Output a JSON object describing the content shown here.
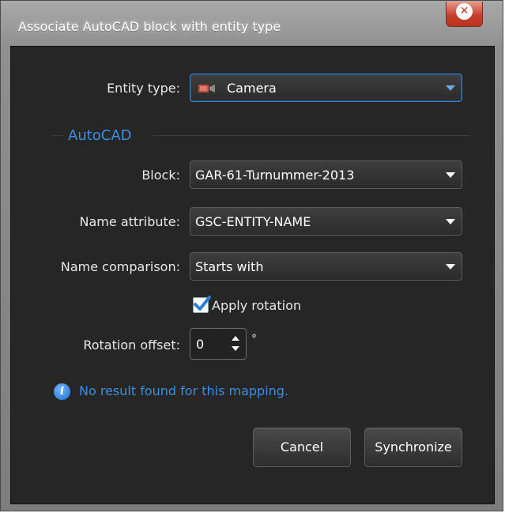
{
  "window": {
    "title": "Associate AutoCAD block with entity type",
    "close_icon": "close-icon"
  },
  "entity_type": {
    "label": "Entity type:",
    "value": "Camera",
    "icon": "camera-icon"
  },
  "section": {
    "title": "AutoCAD"
  },
  "block": {
    "label": "Block:",
    "value": "GAR-61-Turnummer-2013"
  },
  "name_attribute": {
    "label": "Name attribute:",
    "value": "GSC-ENTITY-NAME"
  },
  "name_comparison": {
    "label": "Name comparison:",
    "value": "Starts with"
  },
  "apply_rotation": {
    "label": "Apply rotation",
    "checked": true
  },
  "rotation_offset": {
    "label": "Rotation offset:",
    "value": "0",
    "unit": "°"
  },
  "info": {
    "message": "No result found for this mapping."
  },
  "buttons": {
    "cancel": "Cancel",
    "synchronize": "Synchronize"
  },
  "colors": {
    "accent": "#3c8ee0",
    "panel_bg": "#262626",
    "close_red": "#c8412d"
  }
}
